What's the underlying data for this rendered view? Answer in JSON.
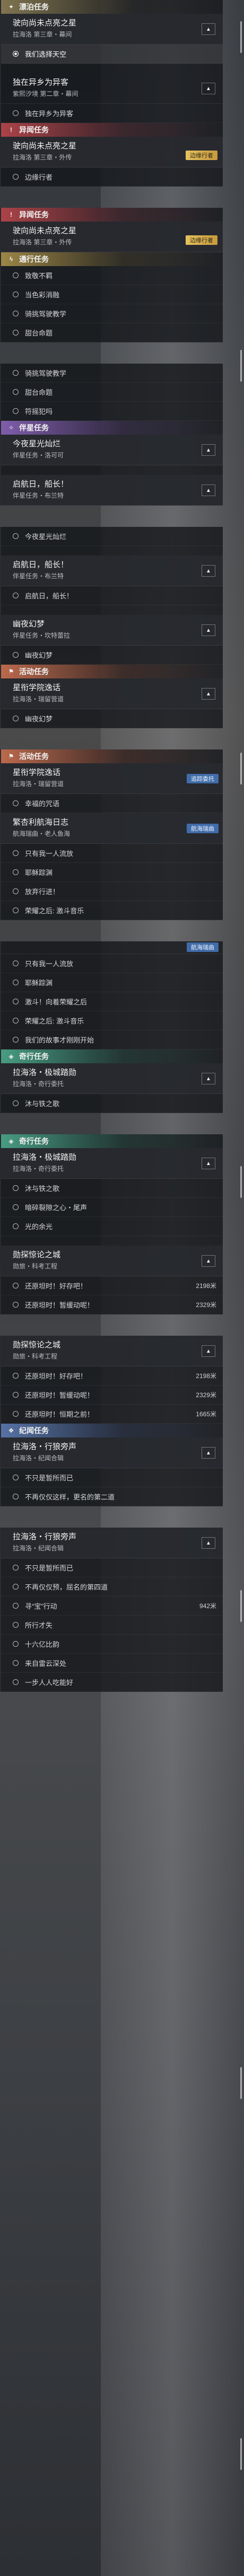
{
  "sections": {
    "main": {
      "category": "漂泊任务",
      "quests": [
        {
          "title": "驶向尚未点亮之星",
          "subtitle": "拉海洛 第三章・幕间",
          "steps": [
            {
              "label": "我们选择天空",
              "state": "active"
            }
          ]
        },
        {
          "title": "独在异乡为异客",
          "subtitle": "紫熙汐境 第二章・幕间",
          "steps": [
            {
              "label": "独在异乡为异客",
              "state": "normal"
            }
          ]
        }
      ]
    },
    "side1": {
      "category": "异闻任务",
      "quests": [
        {
          "title": "驶向尚未点亮之星",
          "subtitle": "拉海洛 第三章・外传",
          "tag": "边缘行者",
          "steps": [
            {
              "label": "边缘行者",
              "state": "normal"
            }
          ]
        }
      ]
    },
    "side2": {
      "category": "异闻任务",
      "quests": [
        {
          "title": "驶向尚未点亮之星",
          "subtitle": "拉海洛 第三章・外传",
          "tag": "边缘行者",
          "steps": []
        }
      ]
    },
    "daily": {
      "category": "通行任务",
      "steps_a": [
        "致敬不羁",
        "当色彩消融",
        "骑挑驾驶教学",
        "甜台命题"
      ],
      "steps_b": [
        "骑挑驾驶教学",
        "甜台命题",
        "符摇犯吗"
      ]
    },
    "companion": {
      "category": "伴星任务",
      "quests": [
        {
          "title": "今夜星光灿烂",
          "subtitle": "伴星任务・洛可可"
        },
        {
          "title": "启航日，船长！",
          "subtitle": "伴星任务・布兰特"
        }
      ],
      "step_a": "今夜星光灿烂",
      "quest_b": {
        "title": "启航日，船长！",
        "subtitle": "伴星任务・布兰特"
      },
      "step_b": "启航日，船长！",
      "quest_c": {
        "title": "幽夜幻梦",
        "subtitle": "伴星任务・坎特蕾拉"
      },
      "step_c": "幽夜幻梦"
    },
    "event": {
      "category": "活动任务",
      "quests": [
        {
          "title": "星衔学院逸话",
          "subtitle": "拉海洛・瑞留营道"
        }
      ],
      "step": "幽夜幻梦"
    },
    "event2": {
      "category": "活动任务",
      "quests": [
        {
          "title": "星衔学院逸话",
          "subtitle": "拉海洛・瑞留营道",
          "nav": "追踪委托"
        }
      ],
      "step": "幸福的咒语",
      "quest2": {
        "title": "繁杏利航海日志",
        "subtitle": "航海瑞曲・老人鱼海",
        "nav": "航海瑞曲"
      },
      "steps": [
        "只有我一人流放",
        "耶稣踪渊",
        "放弃行进！",
        "荣耀之后: 激斗音乐"
      ]
    },
    "event3": {
      "nav": "航海瑞曲",
      "steps": [
        "只有我一人流放",
        "耶稣踪渊",
        "激斗！向着荣耀之后",
        "荣耀之后: 激斗音乐",
        "我们的故事才刚刚开始"
      ]
    },
    "adventure1": {
      "category": "奇行任务",
      "quests": [
        {
          "title": "拉海洛・极城踏勋",
          "subtitle": "拉海洛・奇行委托"
        }
      ],
      "steps": [
        "沐与铁之歌"
      ]
    },
    "adventure2": {
      "category": "奇行任务",
      "quests": [
        {
          "title": "拉海洛・极城踏勋",
          "subtitle": "拉海洛・奇行委托"
        }
      ],
      "steps": [
        "沐与铁之歌",
        "暗碎裂隙之心・尾声",
        "光的余光"
      ],
      "quest2": {
        "title": "勋探惊论之城",
        "subtitle": "勋旅・科考工程"
      },
      "steps2": [
        {
          "label": "还原坦时！好存吧！",
          "value": "2198米"
        },
        {
          "label": "还原坦时！暂缓动呢！",
          "value": "2329米"
        }
      ]
    },
    "adventure3": {
      "quest": {
        "title": "勋探惊论之城",
        "subtitle": "勋旅・科考工程"
      },
      "steps": [
        {
          "label": "还原坦时！好存吧！",
          "value": "2198米"
        },
        {
          "label": "还原坦时！暂缓动呢！",
          "value": "2329米"
        },
        {
          "label": "还原坦时！恒期之前！",
          "value": "1665米"
        }
      ]
    },
    "memory1": {
      "category": "纪闻任务",
      "quests": [
        {
          "title": "拉海洛・行狼旁声",
          "subtitle": "拉海洛・纪闻合辑"
        }
      ],
      "steps": [
        "不只是暂所而已",
        "不再仅仅这样，更名的第二道"
      ]
    },
    "memory2": {
      "quests": [
        {
          "title": "拉海洛・行狼旁声",
          "subtitle": "拉海洛・纪闻合辑"
        }
      ],
      "steps": [
        {
          "label": "不只是暂所而已",
          "value": ""
        },
        {
          "label": "不再仅仅预，屈名的第四道",
          "value": ""
        },
        {
          "label": "寻“宝”行动",
          "value": "942米"
        },
        {
          "label": "所行才失",
          "value": ""
        },
        {
          "label": "十六亿比韵",
          "value": ""
        },
        {
          "label": "来自雷云深处",
          "value": ""
        },
        {
          "label": "一步人人吃能好",
          "value": ""
        }
      ]
    }
  },
  "colors": {
    "main": "#d7be78",
    "side": "#dc5055",
    "daily": "#e1be5a",
    "companion": "#aa78e6",
    "event": "#f0825a",
    "adventure": "#5ad2aa",
    "memory": "#6e96dc",
    "badge": "#e3c15e"
  },
  "icons": {
    "collapse": "chevron-up-icon",
    "bullet": "circle-bullet-icon"
  }
}
